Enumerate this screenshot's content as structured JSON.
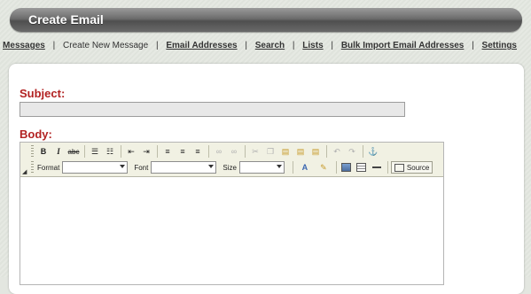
{
  "header": {
    "title": "Create Email"
  },
  "nav": {
    "items": [
      {
        "label": "Messages",
        "current": false
      },
      {
        "label": "Create New Message",
        "current": true
      },
      {
        "label": "Email Addresses",
        "current": false
      },
      {
        "label": "Search",
        "current": false
      },
      {
        "label": "Lists",
        "current": false
      },
      {
        "label": "Bulk Import Email Addresses",
        "current": false
      },
      {
        "label": "Settings",
        "current": false
      }
    ],
    "separator": "|"
  },
  "form": {
    "subject_label": "Subject:",
    "subject_value": "",
    "body_label": "Body:"
  },
  "editor": {
    "row1": [
      {
        "icon": "bold-icon",
        "glyph": "B"
      },
      {
        "icon": "italic-icon",
        "glyph": "I"
      },
      {
        "icon": "strikethrough-icon",
        "glyph": "abc"
      },
      {
        "icon": "numbered-list-icon",
        "glyph": "☰"
      },
      {
        "icon": "bulleted-list-icon",
        "glyph": "☷"
      },
      {
        "icon": "outdent-icon",
        "glyph": "⇤"
      },
      {
        "icon": "indent-icon",
        "glyph": "⇥"
      },
      {
        "icon": "align-left-icon",
        "glyph": "≡"
      },
      {
        "icon": "align-center-icon",
        "glyph": "≡"
      },
      {
        "icon": "align-right-icon",
        "glyph": "≡"
      },
      {
        "icon": "link-icon",
        "glyph": "∞"
      },
      {
        "icon": "unlink-icon",
        "glyph": "∞"
      },
      {
        "icon": "cut-icon",
        "glyph": "✂"
      },
      {
        "icon": "copy-icon",
        "glyph": "❐"
      },
      {
        "icon": "paste-icon",
        "glyph": "▤"
      },
      {
        "icon": "paste-text-icon",
        "glyph": "▤"
      },
      {
        "icon": "paste-word-icon",
        "glyph": "▤"
      },
      {
        "icon": "undo-icon",
        "glyph": "↶"
      },
      {
        "icon": "redo-icon",
        "glyph": "↷"
      },
      {
        "icon": "anchor-icon",
        "glyph": "⚓"
      }
    ],
    "format_label": "Format",
    "font_label": "Font",
    "size_label": "Size",
    "source_label": "Source",
    "text_color_glyph": "A",
    "bg_color_glyph": "✎"
  }
}
